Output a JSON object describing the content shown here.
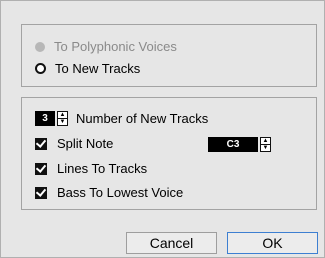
{
  "mode": {
    "option_polyphonic": "To Polyphonic Voices",
    "option_new_tracks": "To New Tracks"
  },
  "options": {
    "number_value": "3",
    "number_label": "Number of New Tracks",
    "split_note_label": "Split Note",
    "split_note_value": "C3",
    "lines_to_tracks_label": "Lines To Tracks",
    "bass_label": "Bass To Lowest Voice"
  },
  "buttons": {
    "cancel": "Cancel",
    "ok": "OK"
  }
}
